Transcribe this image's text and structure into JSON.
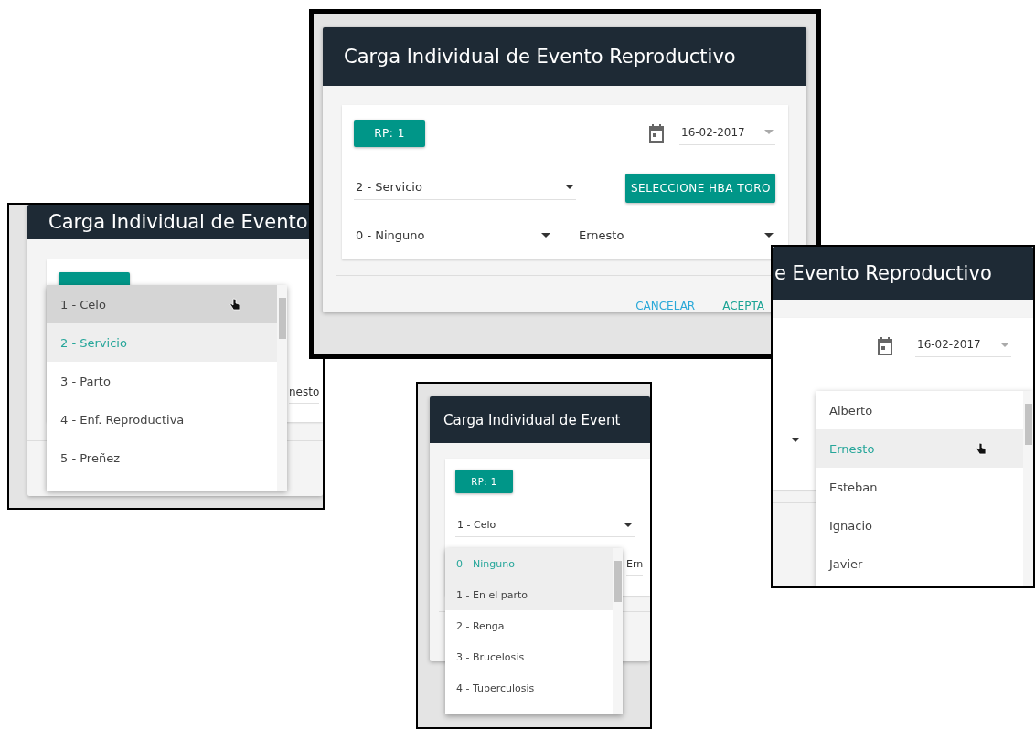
{
  "screenshots": [
    {
      "kind": "left",
      "title": "Carga Individual de Evento",
      "side_text": "nesto",
      "menu": [
        {
          "label": "1 - Celo",
          "selected": false,
          "hovered": true
        },
        {
          "label": "2 - Servicio",
          "selected": true,
          "hovered": false
        },
        {
          "label": "3 - Parto",
          "selected": false,
          "hovered": false
        },
        {
          "label": "4 - Enf. Reproductiva",
          "selected": false,
          "hovered": false
        },
        {
          "label": "5 - Preñez",
          "selected": false,
          "hovered": false
        }
      ]
    },
    {
      "kind": "main",
      "title": "Carga Individual de Evento Reproductivo",
      "rp_button": "RP: 1",
      "date": "16-02-2017",
      "event_select": "2 - Servicio",
      "bull_button": "SELECCIONE HBA TORO",
      "disease_select": "0 - Ninguno",
      "operator_select": "Ernesto",
      "actions": [
        {
          "label": "CANCELAR",
          "kind": "cancel"
        },
        {
          "label": "ACEPTA",
          "kind": "confirm"
        }
      ]
    },
    {
      "kind": "bottom",
      "title": "Carga Individual de Event",
      "rp_button": "RP: 1",
      "event_select": "1 - Celo",
      "side_text": "Ern",
      "menu": [
        {
          "label": "0 - Ninguno",
          "selected": true,
          "hovered": false
        },
        {
          "label": "1 - En el parto",
          "selected": false,
          "hovered": true
        },
        {
          "label": "2 - Renga",
          "selected": false,
          "hovered": false
        },
        {
          "label": "3 - Brucelosis",
          "selected": false,
          "hovered": false
        },
        {
          "label": "4 - Tuberculosis",
          "selected": false,
          "hovered": false
        }
      ]
    },
    {
      "kind": "right",
      "title": "e Evento Reproductivo",
      "date": "16-02-2017",
      "menu": [
        {
          "label": "Alberto",
          "selected": false,
          "hovered": false
        },
        {
          "label": "Ernesto",
          "selected": true,
          "hovered": true
        },
        {
          "label": "Esteban",
          "selected": false,
          "hovered": false
        },
        {
          "label": "Ignacio",
          "selected": false,
          "hovered": false
        },
        {
          "label": "Javier",
          "selected": false,
          "hovered": false
        }
      ]
    }
  ]
}
